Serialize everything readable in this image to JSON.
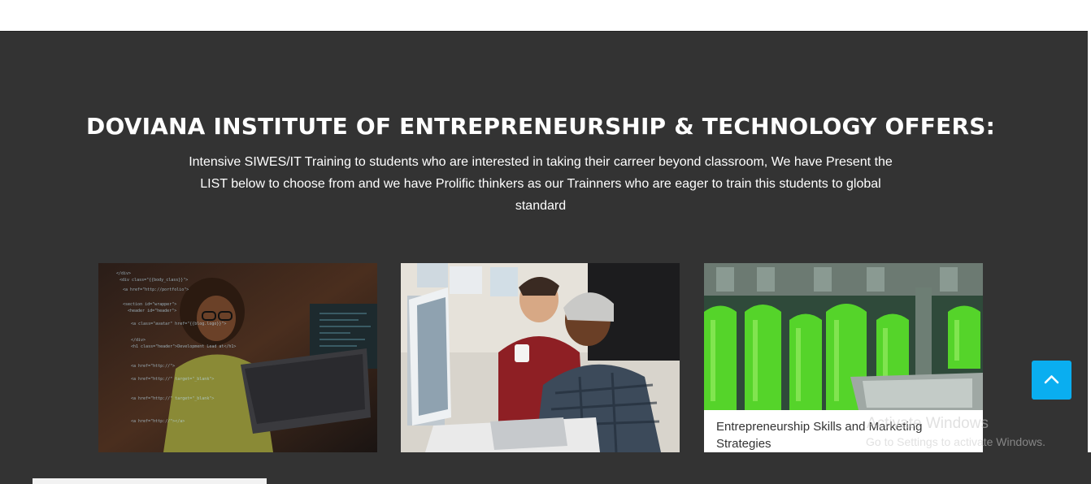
{
  "section": {
    "heading": "DOVIANA INSTITUTE OF ENTREPRENEURSHIP & TECHNOLOGY OFFERS:",
    "intro": "Intensive SIWES/IT Training to students who are interested in taking their carreer beyond classroom, We have Present the LIST below to choose from and we have Prolific thinkers as our Trainners who are eager to train this students to global standard"
  },
  "cards": [
    {
      "image": "woman-coding-laptop-photo"
    },
    {
      "image": "students-at-computer-photo"
    },
    {
      "image": "green-bottles-production-photo",
      "caption": "Entrepreneurship Skills and Marketing Strategies"
    }
  ],
  "scroll_top": {
    "icon": "chevron-up-icon",
    "color": "#0aaef0"
  },
  "watermark": {
    "title": "Activate Windows",
    "subtitle": "Go to Settings to activate Windows."
  },
  "colors": {
    "background": "#333333",
    "accent": "#0aaef0",
    "text": "#ffffff"
  }
}
